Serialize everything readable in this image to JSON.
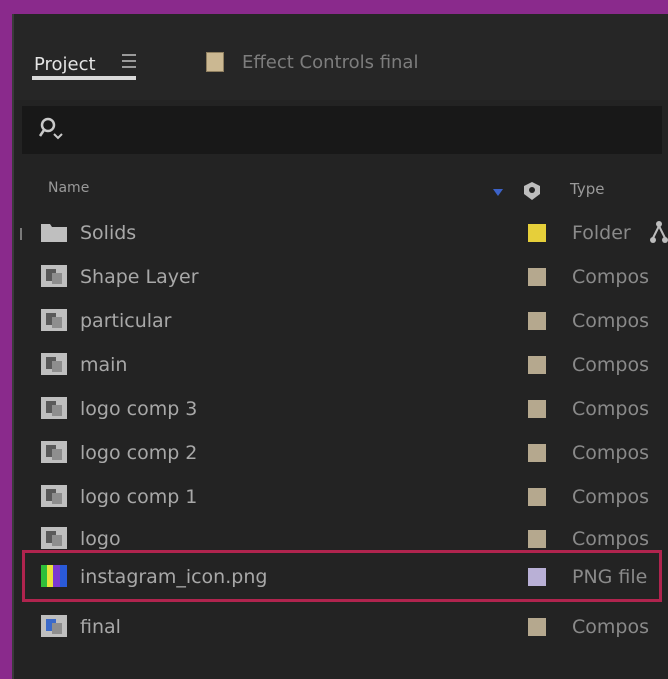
{
  "panel": {
    "tabs": [
      {
        "label": "Project",
        "active": true
      },
      {
        "label": "Effect Controls final",
        "active": false
      }
    ],
    "search": {
      "value": "",
      "placeholder": ""
    }
  },
  "columns": {
    "name": "Name",
    "type": "Type"
  },
  "colors": {
    "folder_label": "#e6cf3a",
    "comp_label": "#b5a88e",
    "png_label": "#b9b0d6",
    "selection_outline": "#b0244e"
  },
  "items": [
    {
      "name": "Solids",
      "type": "Folder",
      "icon": "folder-icon",
      "label_color": "#e6cf3a"
    },
    {
      "name": "Shape Layer",
      "type": "Compos",
      "icon": "composition-icon",
      "label_color": "#b5a88e"
    },
    {
      "name": "particular",
      "type": "Compos",
      "icon": "composition-icon",
      "label_color": "#b5a88e"
    },
    {
      "name": "main",
      "type": "Compos",
      "icon": "composition-icon",
      "label_color": "#b5a88e"
    },
    {
      "name": "logo comp 3",
      "type": "Compos",
      "icon": "composition-icon",
      "label_color": "#b5a88e"
    },
    {
      "name": "logo comp 2",
      "type": "Compos",
      "icon": "composition-icon",
      "label_color": "#b5a88e"
    },
    {
      "name": "logo comp 1",
      "type": "Compos",
      "icon": "composition-icon",
      "label_color": "#b5a88e"
    },
    {
      "name": "logo",
      "type": "Compos",
      "icon": "composition-icon",
      "label_color": "#b5a88e"
    },
    {
      "name": "instagram_icon.png",
      "type": "PNG file",
      "icon": "image-file-icon",
      "label_color": "#b9b0d6",
      "selected": true
    },
    {
      "name": "final",
      "type": "Compos",
      "icon": "composition-icon",
      "label_color": "#b5a88e"
    }
  ]
}
